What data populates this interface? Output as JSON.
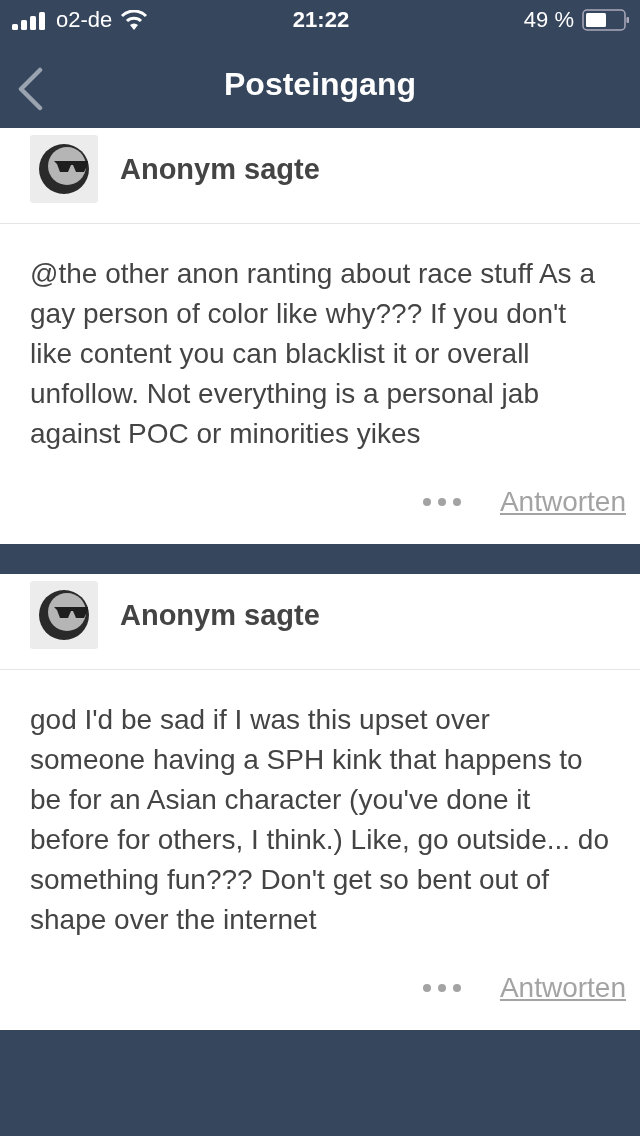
{
  "status_bar": {
    "carrier": "o2-de",
    "time": "21:22",
    "battery": "49 %"
  },
  "nav": {
    "title": "Posteingang"
  },
  "messages": [
    {
      "sender": "Anonym sagte",
      "body": "@the other anon ranting about race stuff As a gay person of color like why??? If you don't like content you can blacklist it or overall unfollow. Not everything is a personal jab against POC or minorities yikes",
      "reply": "Antworten"
    },
    {
      "sender": "Anonym sagte",
      "body": "god I'd be sad if I was this upset over someone having a SPH kink that happens to be for an Asian character (you've done it before for others, I think.) Like, go outside... do something fun??? Don't get so bent out of shape over the internet",
      "reply": "Antworten"
    }
  ]
}
